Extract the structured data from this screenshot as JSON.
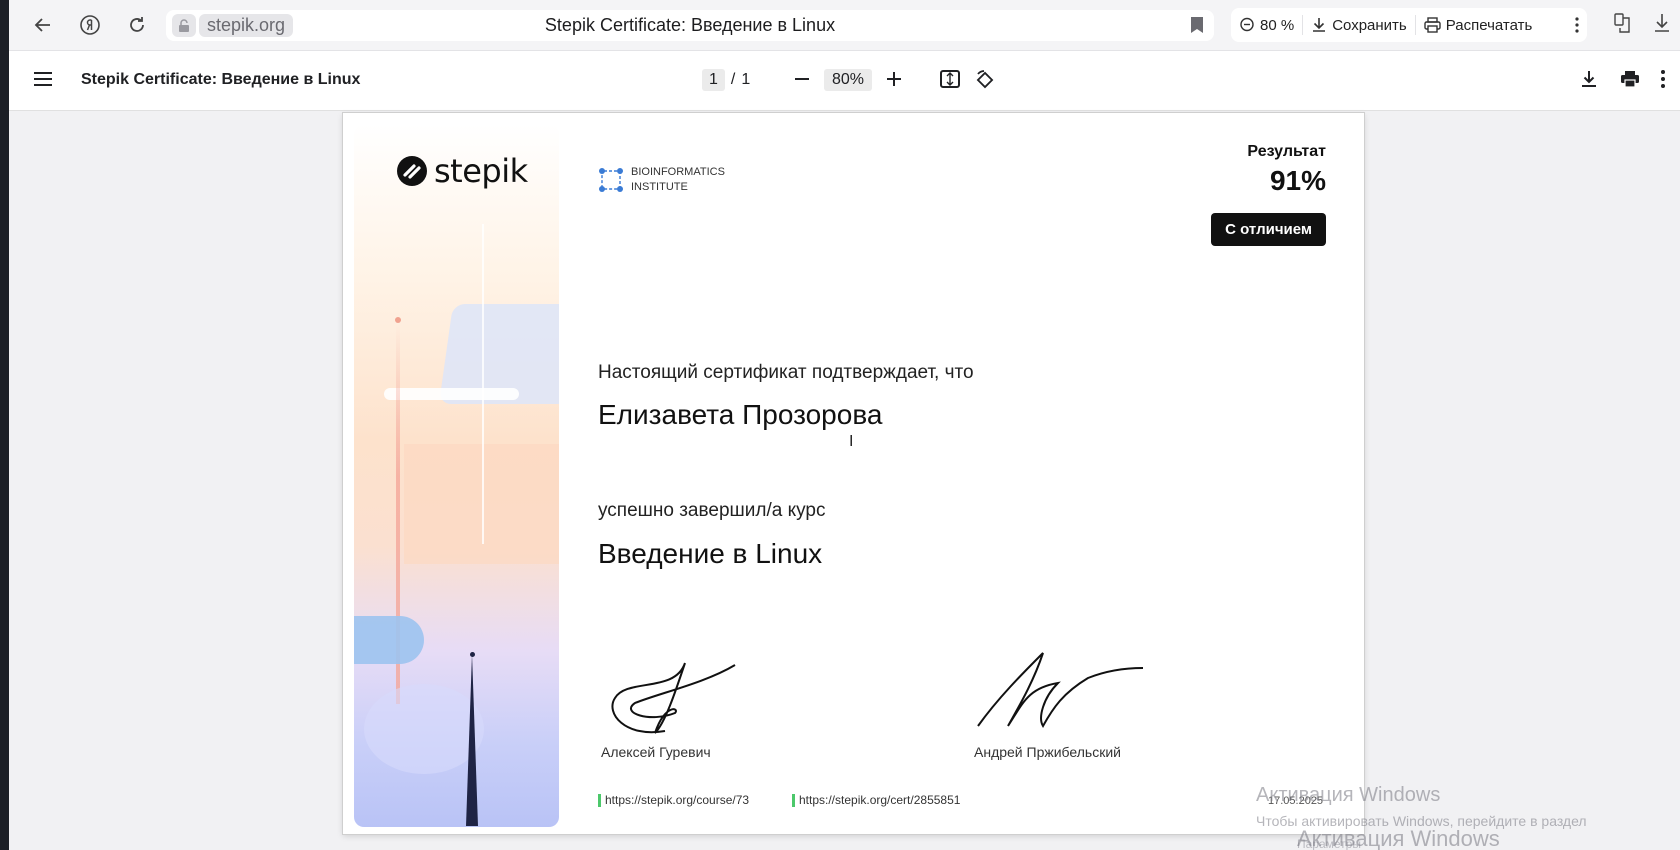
{
  "browser": {
    "domain": "stepik.org",
    "tab_title": "Stepik Certificate: Введение в Linux",
    "zoom": "80 %",
    "save_label": "Сохранить",
    "print_label": "Распечатать"
  },
  "pdf_toolbar": {
    "title": "Stepik Certificate: Введение в Linux",
    "current_page": "1",
    "separator": "/",
    "total_pages": "1",
    "zoom": "80%"
  },
  "certificate": {
    "brand": "stepik",
    "institute_line1": "BIOINFORMATICS",
    "institute_line2": "INSTITUTE",
    "result_label": "Результат",
    "result_value": "91%",
    "badge": "С отличием",
    "intro": "Настоящий сертификат подтверждает, что",
    "recipient": "Елизавета Прозорова",
    "completed": "успешно завершил/а  курс",
    "course": "Введение в Linux",
    "signer1": "Алексей Гуревич",
    "signer2": "Андрей Пржибельский",
    "course_link": "https://stepik.org/course/73",
    "cert_link": "https://stepik.org/cert/2855851",
    "date": "17.05.2025"
  },
  "watermark": {
    "line1": "Активация Windows",
    "line2": "Чтобы активировать Windows, перейдите в раздел",
    "line3": "Активация Windows",
    "line4": "Параметры"
  },
  "colors": {
    "accent_green": "#4cc86b",
    "badge_bg": "#111111",
    "institute_blue": "#3a7bd5"
  }
}
